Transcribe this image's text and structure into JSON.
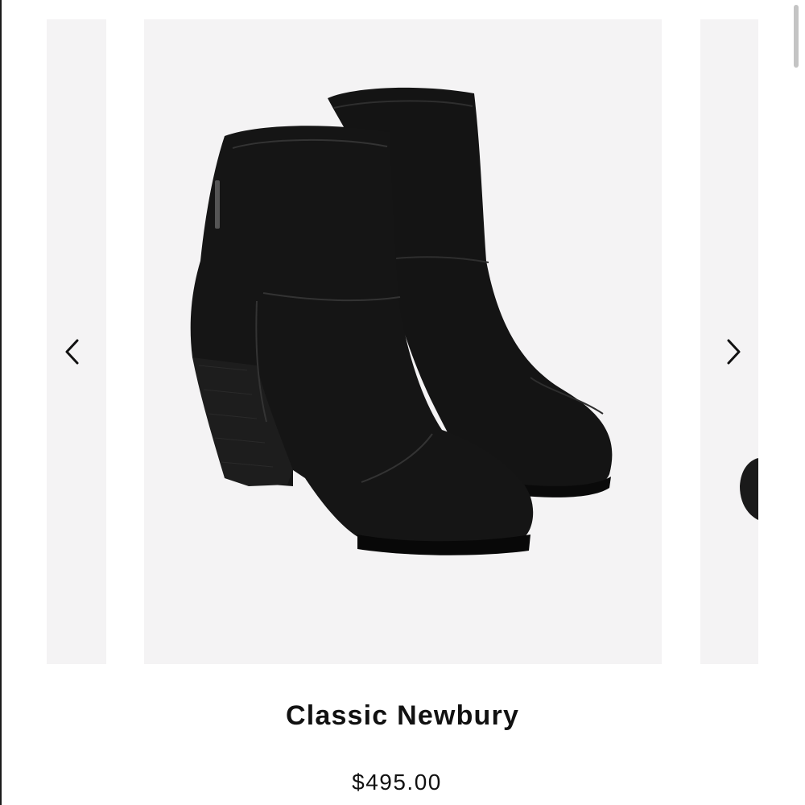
{
  "product": {
    "title": "Classic Newbury",
    "price": "$495.00"
  },
  "carousel": {
    "prev_icon": "chevron-left-icon",
    "next_icon": "chevron-right-icon",
    "slide_background": "#f4f3f4"
  },
  "colors": {
    "text": "#111111",
    "boot": "#141414"
  }
}
